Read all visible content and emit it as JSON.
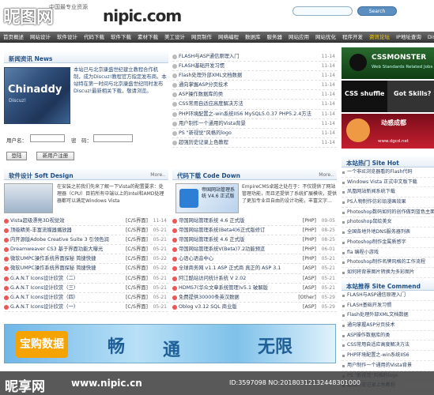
{
  "header": {
    "logo_text": "昵图网",
    "watermark": "nipic.com",
    "sub": "中国最专业资源",
    "search_button": "Search"
  },
  "nav": [
    "首页概述",
    "网站设计",
    "软件设计",
    "代码下载",
    "软件下载",
    "素材下载",
    "美工设计",
    "网页制作",
    "网络编程",
    "数据库",
    "服务器",
    "网站应用",
    "网站优化",
    "程序开发",
    "资讯论坛",
    "IP地址查询",
    "Discuz"
  ],
  "news": {
    "title": "新闻资讯 News",
    "more": "More..",
    "img_brand": "Chinaddy",
    "img_tag": "Discuz!",
    "text": "本站已与北京康盛世纪建立教程合作机制，成为Discuz!教程官方指定发布商。本站特在第一时间与北京康盛世纪同时发布Discuz!最新相关下载，敬请浏览。",
    "login": {
      "user_label": "用户名：",
      "pass_label": "密　码：",
      "login_btn": "登陆",
      "register_btn": "新用户注册"
    }
  },
  "center_list": [
    {
      "text": "FLASH与ASP通信原理入门",
      "date": "11-14"
    },
    {
      "text": "FLASH基础开发习惯",
      "date": "11-14"
    },
    {
      "text": "Flash处理外部XML文档数据",
      "date": "11-14"
    },
    {
      "text": "通向掌握ASP分页技术",
      "date": "11-14"
    },
    {
      "text": "ASP操作数据库的类",
      "date": "11-14"
    },
    {
      "text": "CSS常用自适应高度解决方法",
      "date": "11-14"
    },
    {
      "text": "PHP环境配置之-win系统IIS6 MySQL5.0.37 PHP5.2.4方法",
      "date": "11-14"
    },
    {
      "text": "用户制作一个通用的Vista背景",
      "date": "11-14"
    },
    {
      "text": "PS \"新视觉\"风格的logo",
      "date": "11-14"
    },
    {
      "text": "超强历史记录上色教程",
      "date": "11-14"
    }
  ],
  "software_design": {
    "title": "软件设计 Soft Design",
    "more": "More..",
    "desc": "在安装之前我们先来了解一下Vista的配置要求：处理器（CPU）目前所有中端以上的Intel和AMD处理器都可以满足Windows Vista",
    "items": [
      {
        "text": "Vista超级漂亮3D视觉效",
        "cat": "[C/S界面]",
        "date": "11-14"
      },
      {
        "text": "顶级精美-丰富流媒器播放器",
        "cat": "[C/S界面]",
        "date": "05-21"
      },
      {
        "text": "内开源版Adobe Creative Suite 3 引领色润",
        "cat": "[C/S界面]",
        "date": "05-21"
      },
      {
        "text": "Dreamweaver CS3 基于界面功能大曝光",
        "cat": "[C/S界面]",
        "date": "05-21"
      },
      {
        "text": "微软UMPC操作系统界面探秘 简捷快捷",
        "cat": "[C/S界面]",
        "date": "05-22"
      },
      {
        "text": "微软UMPC操作系统界面探秘 简捷快捷",
        "cat": "[C/S界面]",
        "date": "05-22"
      },
      {
        "text": "G.A.N.T Icons设计欣赏（二）",
        "cat": "[C/S界面]",
        "date": "05-21"
      },
      {
        "text": "G.A.N.T Icons设计欣赏（三）",
        "cat": "[C/S界面]",
        "date": "05-21"
      },
      {
        "text": "G.A.N.T Icons设计欣赏（四）",
        "cat": "[C/S界面]",
        "date": "05-21"
      },
      {
        "text": "G.A.N.T Icons设计欣赏（一）",
        "cat": "[C/S界面]",
        "date": "05-21"
      }
    ]
  },
  "code_download": {
    "title": "代码下载 Code Down",
    "more": "More..",
    "thumb_text": "帝国网站管理系统 V4.6 正式版",
    "desc": "EmpireCMS卓越之处在于：不仅提供了网站管理功能，而且还提供了系统扩展模块，提供了更加专业且自由的设计功能，丰富文字...",
    "items": [
      {
        "text": "帝国网站管理系统 4.6 正式版",
        "cat": "[PHP]",
        "date": "09-05"
      },
      {
        "text": "帝国网站管理系统(Beta4)6正式版修订",
        "cat": "[PHP]",
        "date": "08-25"
      },
      {
        "text": "帝国网站管理系统 4.6 正式版",
        "cat": "[PHP]",
        "date": "08-25"
      },
      {
        "text": "帝国网站管理系统V(Beta)7.2功能预览",
        "cat": "[PHP]",
        "date": "06-01"
      },
      {
        "text": "心语心语音中心",
        "cat": "[PHP]",
        "date": "05-21"
      },
      {
        "text": "全球商务网 v1.1 ASP 正式商 真正的 ASP 3.1",
        "cat": "[ASP]",
        "date": "05-21"
      },
      {
        "text": "阿江酷站访问统计系统 V 2.02",
        "cat": "[ASP]",
        "date": "05-21"
      },
      {
        "text": "HDMS7(华众文章系统管理)v5.1 破解版",
        "cat": "[ASP]",
        "date": "05-21"
      },
      {
        "text": "免费提供30000条英汉数据",
        "cat": "[Other]",
        "date": "05-29"
      },
      {
        "text": "Oblog v3.12 SQL 商业版",
        "cat": "[ASP]",
        "date": "05-29"
      }
    ]
  },
  "sidebar": {
    "ad1_title": "CSSMONSTER",
    "ad1_sub": "Web Standards Related Jobs",
    "ad2_a": "CSS shuffle",
    "ad2_b": "Got Skills?",
    "ad3": "动感成都",
    "ad3_sub": "www.dgcd.net",
    "hot_title": "本站热门 Site Hot",
    "hot": [
      "一个非IE浏览器看的Flash代码",
      "Windows Vista 正式中文版下载",
      "凤凰网站新闻系统下载",
      "PS人物制作仿彩铅漫画效果",
      "Photoshop数码如何的创作做到蓝色主面",
      "photoshop鼠绘美女",
      "全国各地外地DNS服务器列表",
      "Photoshop制作金属质感字",
      "fla 编程小游戏",
      "Photoshop制作名牌风格的工作流程",
      "如何将背景图片转换为多彩图片"
    ],
    "rec_title": "本站推荐 Site Commend",
    "rec": [
      "FLASH与ASP通信原理入门",
      "FLASH基础开发习惯",
      "Flash处理外部XML文档数据",
      "通向掌握ASP分页技术",
      "ASP操作数据库的类",
      "CSS常用自适应高度解决方法",
      "PHP环境配置之-win系统IIS6",
      "用户制作一个通用的Vista背景",
      "PS \"新视觉\"风格的logo",
      "超强历史记录上色教程"
    ]
  },
  "banner": {
    "logo": "宝购数据",
    "w1": "畅",
    "w2": "通",
    "w3": "无限"
  },
  "footer": {
    "logo": "昵享网",
    "url": "www.nipic.cn",
    "id": "ID:3597098 NO:20180312132448301000"
  }
}
